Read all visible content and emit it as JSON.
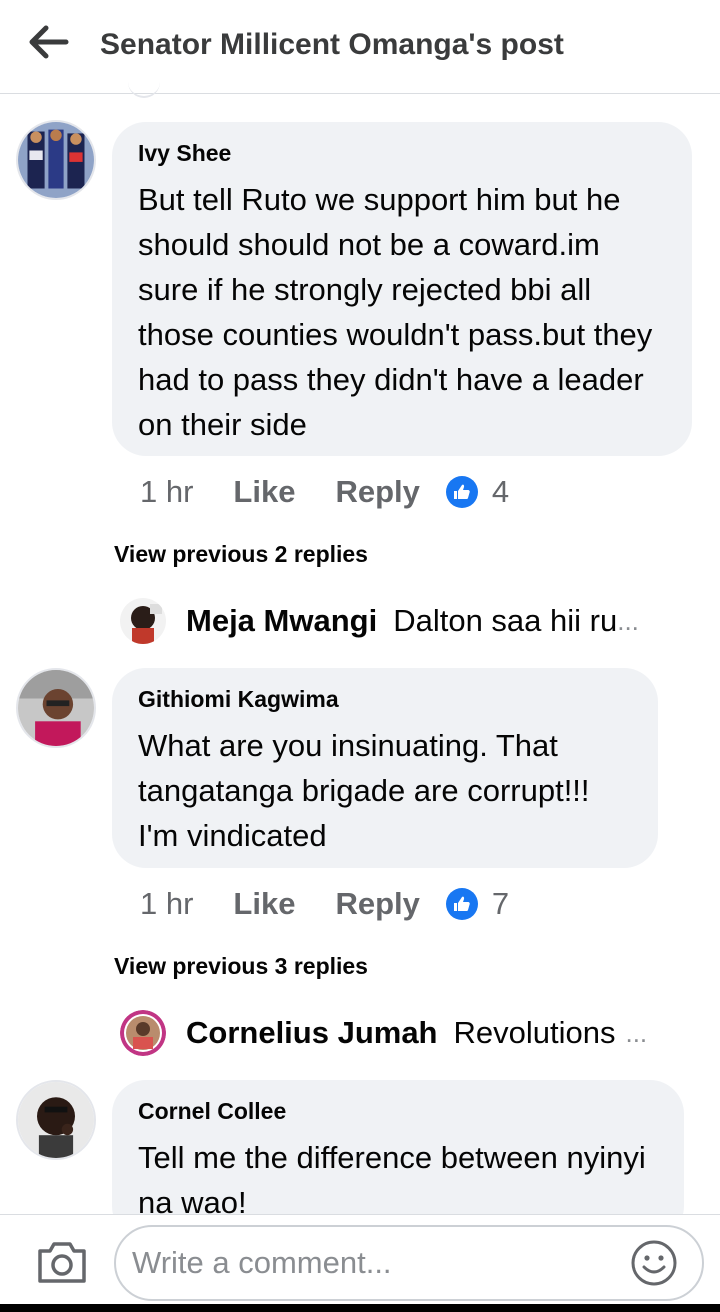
{
  "header": {
    "back_icon": "arrow-left-icon",
    "title": "Senator Millicent Omanga's post"
  },
  "comments": [
    {
      "author": "Ivy Shee",
      "text": "But tell Ruto we support him but he should should not be a coward.im sure if he strongly rejected bbi all those counties wouldn't pass.but they had to pass they didn't have a leader on their side",
      "time": "1 hr",
      "like_label": "Like",
      "reply_label": "Reply",
      "reactions": "4",
      "view_previous": "View previous 2 replies",
      "reply_preview": {
        "name": "Meja Mwangi",
        "text": "Dalton saa hii ru",
        "ellipsis": "..."
      }
    },
    {
      "author": "Githiomi Kagwima",
      "text": "What are you insinuating. That tangatanga brigade are corrupt!!! I'm vindicated",
      "time": "1 hr",
      "like_label": "Like",
      "reply_label": "Reply",
      "reactions": "7",
      "view_previous": "View previous 3 replies",
      "reply_preview": {
        "name": "Cornelius Jumah",
        "text": "Revolutions",
        "ellipsis": "..."
      }
    },
    {
      "author": "Cornel Collee",
      "text": "Tell me the difference between nyinyi na wao!"
    }
  ],
  "footer": {
    "camera_icon": "camera-icon",
    "comment_placeholder": "Write a comment...",
    "emoji_icon": "smiley-icon"
  },
  "colors": {
    "like_blue": "#1877f2",
    "bubble": "#f0f2f5",
    "secondary_text": "#65676b"
  }
}
